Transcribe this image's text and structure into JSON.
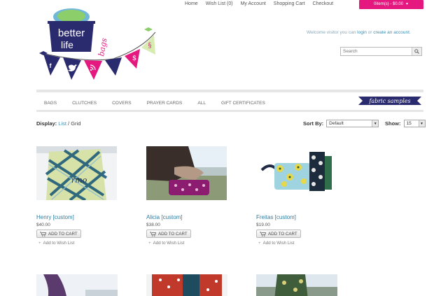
{
  "top_links": [
    "Home",
    "Wish List (0)",
    "My Account",
    "Shopping Cart",
    "Checkout"
  ],
  "cart": {
    "label": "0item(s) - $0.00"
  },
  "welcome": {
    "prefix": "Welcome visitor you can ",
    "login": "login",
    "middle": " or ",
    "create": "create an account",
    "suffix": "."
  },
  "search": {
    "placeholder": "Search"
  },
  "logo": {
    "line1": "better",
    "line2": "life",
    "line3": "bags"
  },
  "nav": [
    "BAGS",
    "CLUTCHES",
    "COVERS",
    "PRAYER CARDS",
    "ALL",
    "GIFT CERTIFICATES"
  ],
  "fabric_banner": "fabric samples",
  "toolbar": {
    "display_label": "Display:",
    "list": "List",
    "sep": " / ",
    "grid": "Grid",
    "sort_label": "Sort By:",
    "sort_value": "Default",
    "show_label": "Show:",
    "show_value": "15"
  },
  "products": [
    {
      "name": "Henry [custom]",
      "price": "$40.00",
      "add": "ADD TO CART",
      "wish": "Add to Wish List"
    },
    {
      "name": "Alicia [custom]",
      "price": "$38.00",
      "add": "ADD TO CART",
      "wish": "Add to Wish List"
    },
    {
      "name": "Freitas [custom]",
      "price": "$19.00",
      "add": "ADD TO CART",
      "wish": "Add to Wish List"
    }
  ],
  "colors": {
    "accent": "#e4187f",
    "link": "#2e7c9f",
    "navy": "#2a2a6e"
  }
}
